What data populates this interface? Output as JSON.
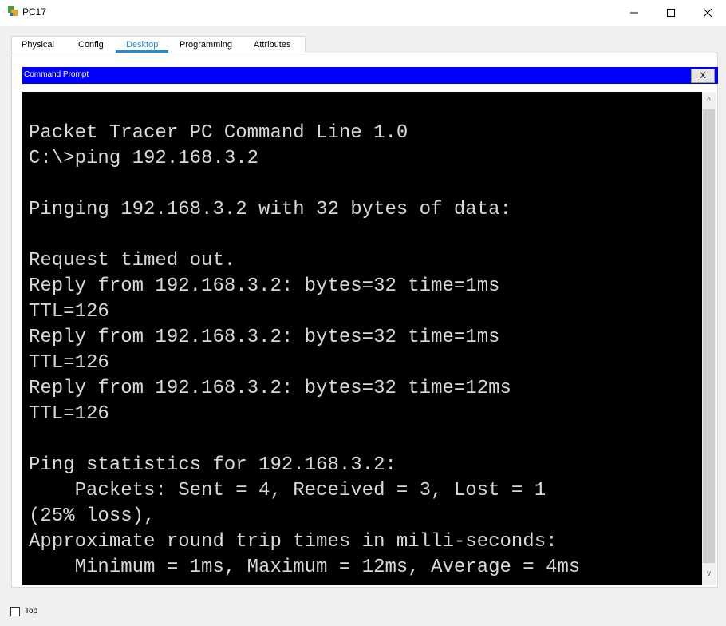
{
  "window": {
    "title": "PC17",
    "icon": "packet-tracer-pc-icon",
    "controls": {
      "minimize": "—",
      "maximize": "☐",
      "close": "✕"
    }
  },
  "tabs": [
    {
      "label": "Physical",
      "active": false
    },
    {
      "label": "Config",
      "active": false
    },
    {
      "label": "Desktop",
      "active": true
    },
    {
      "label": "Programming",
      "active": false
    },
    {
      "label": "Attributes",
      "active": false
    }
  ],
  "command_prompt": {
    "title": "Command Prompt",
    "close_label": "X",
    "lines": [
      "Packet Tracer PC Command Line 1.0",
      "C:\\>ping 192.168.3.2",
      "",
      "Pinging 192.168.3.2 with 32 bytes of data:",
      "",
      "Request timed out.",
      "Reply from 192.168.3.2: bytes=32 time=1ms",
      "TTL=126",
      "Reply from 192.168.3.2: bytes=32 time=1ms",
      "TTL=126",
      "Reply from 192.168.3.2: bytes=32 time=12ms",
      "TTL=126",
      "",
      "Ping statistics for 192.168.3.2:",
      "    Packets: Sent = 4, Received = 3, Lost = 1",
      "(25% loss),",
      "Approximate round trip times in milli-seconds:",
      "    Minimum = 1ms, Maximum = 12ms, Average = 4ms"
    ]
  },
  "scrollbar": {
    "up": "^",
    "down": "v"
  },
  "bottom": {
    "top_checkbox_label": "Top",
    "top_checked": false
  },
  "colors": {
    "accent": "#1f8dd6",
    "cmd_header": "#0000ff",
    "terminal_bg": "#000000",
    "terminal_fg": "#d8d8d8"
  }
}
